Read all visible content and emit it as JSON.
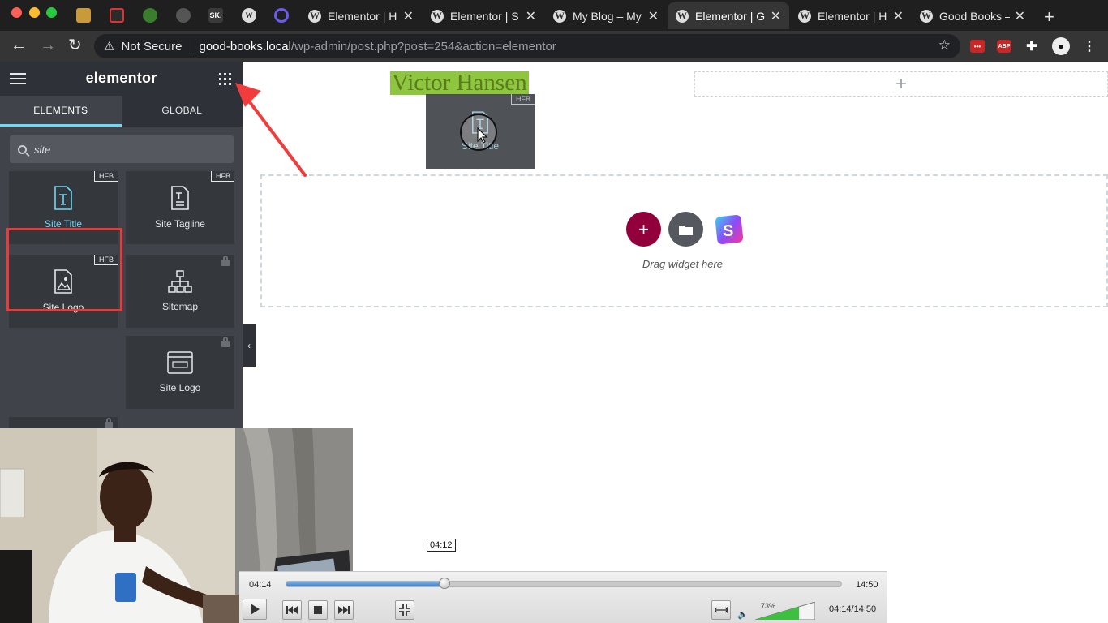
{
  "browser": {
    "tabs": [
      {
        "title": "Elementor | H",
        "active": false
      },
      {
        "title": "Elementor | S",
        "active": false
      },
      {
        "title": "My Blog – My",
        "active": false
      },
      {
        "title": "Elementor | G",
        "active": true
      },
      {
        "title": "Elementor | H",
        "active": false
      },
      {
        "title": "Good Books –",
        "active": false
      }
    ],
    "security_label": "Not Secure",
    "url_host": "good-books.local",
    "url_path": "/wp-admin/post.php?post=254&action=elementor",
    "pinned_labels": {
      "sk": "SK.",
      "abp": "ABP"
    }
  },
  "panel": {
    "logo": "elementor",
    "tabs": [
      "ELEMENTS",
      "GLOBAL"
    ],
    "search_value": "site",
    "widgets": [
      {
        "label": "Site Title",
        "badge": "HFB",
        "icon": "site-title-icon"
      },
      {
        "label": "Site Tagline",
        "badge": "HFB",
        "icon": "site-tagline-icon"
      },
      {
        "label": "Site Logo",
        "badge": "HFB",
        "icon": "site-logo-icon"
      },
      {
        "label": "Sitemap",
        "badge": "",
        "icon": "sitemap-icon"
      },
      {
        "label": "Site Logo",
        "badge": "",
        "icon": "site-logo-pro-icon"
      }
    ]
  },
  "canvas": {
    "site_title": "Victor Hansen",
    "ghost_label": "Site Title",
    "ghost_badge": "HFB",
    "drop_text": "Drag widget here"
  },
  "player": {
    "tooltip_time": "04:12",
    "current_time": "04:14",
    "total_time": "14:50",
    "time_readout": "04:14/14:50",
    "progress": 0.285,
    "volume_percent": "73%",
    "volume": 0.73
  },
  "colors": {
    "accent_tab": "#71d7f7",
    "highlight_box": "#e63c3c",
    "add_button": "#92003b",
    "site_title_bg": "#8ec63f"
  }
}
